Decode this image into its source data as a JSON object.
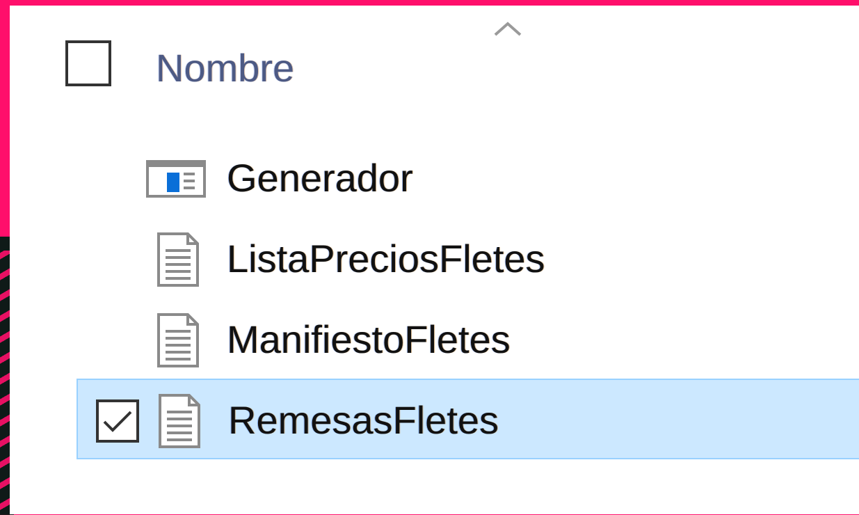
{
  "header": {
    "column_label": "Nombre",
    "sort": "ascending",
    "sort_icon": "chevron-up-icon",
    "select_all_checked": false
  },
  "items": [
    {
      "label": "Generador",
      "icon": "form-icon",
      "selected": false
    },
    {
      "label": "ListaPreciosFletes",
      "icon": "document-icon",
      "selected": false
    },
    {
      "label": "ManifiestoFletes",
      "icon": "document-icon",
      "selected": false
    },
    {
      "label": "RemesasFletes",
      "icon": "document-icon",
      "selected": true
    }
  ],
  "colors": {
    "selection_bg": "#cce8ff",
    "selection_border": "#99d1ff",
    "header_text": "#4d5a84",
    "accent_blue": "#0a6fd8",
    "frame": "#ff0f6b"
  }
}
